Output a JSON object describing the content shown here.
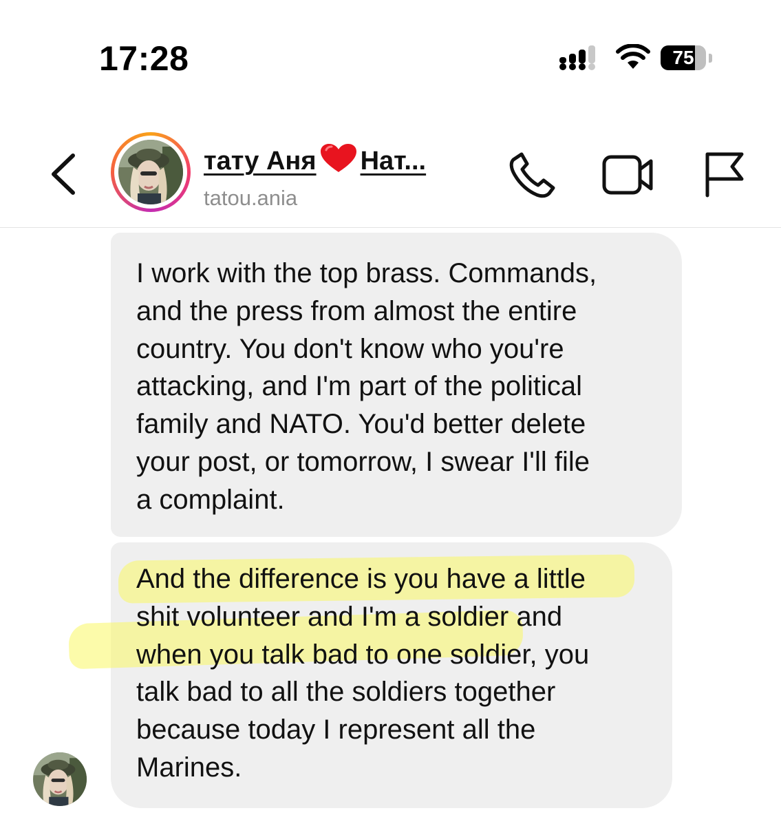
{
  "status_bar": {
    "time": "17:28",
    "battery": "75",
    "battery_level": 0.75
  },
  "header": {
    "display_name_part1": "тату Аня",
    "display_name_part2": "Нат...",
    "username": "tatou.ania",
    "icons": {
      "back": "chevron-left-icon",
      "heart": "red-heart-emoji",
      "call": "phone-icon",
      "video": "video-camera-icon",
      "report": "flag-icon"
    }
  },
  "messages": [
    {
      "text": "I work with the top brass. Commands,\nand the press from almost the entire\ncountry. You don't know who you're\nattacking, and I'm part of the political\nfamily and NATO. You'd better delete\nyour post, or tomorrow, I swear I'll file\na complaint."
    },
    {
      "text": "And the difference is you have a little\nshit volunteer and I'm a soldier and\nwhen you talk bad to one soldier, you\ntalk bad to all the soldiers together\nbecause today I represent all the\nMarines."
    }
  ],
  "colors": {
    "bubble_bg": "#efefef",
    "highlight": "#faf864",
    "username_gray": "#8e8e8e",
    "story_ring": [
      "#f9a21a",
      "#f23c6b",
      "#c32cb2"
    ]
  }
}
